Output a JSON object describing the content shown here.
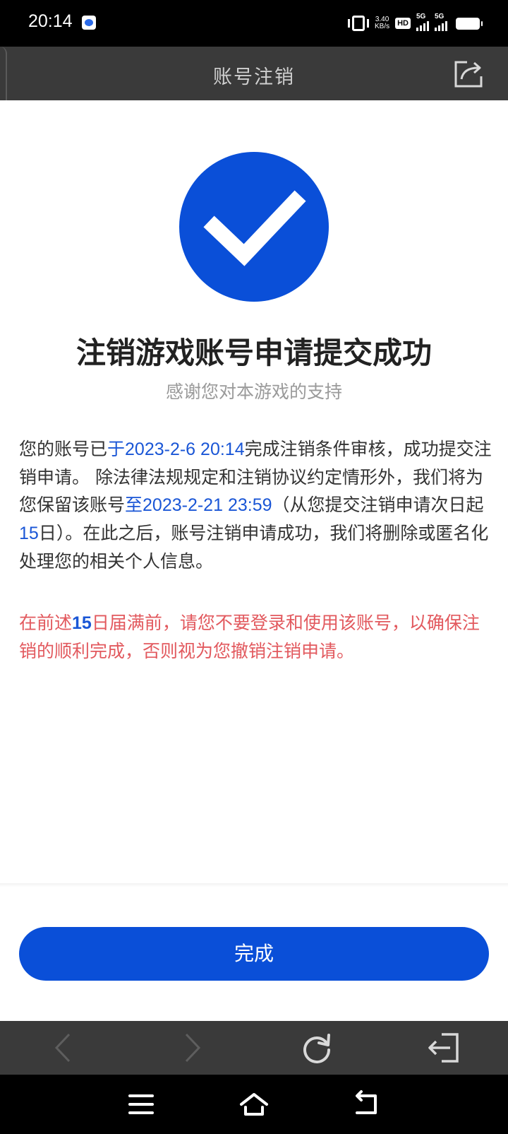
{
  "status_bar": {
    "time": "20:14",
    "net_speed_value": "3.40",
    "net_speed_unit": "KB/s",
    "hd_label": "HD",
    "signal_label_1": "5G",
    "signal_label_2": "5G"
  },
  "header": {
    "title": "账号注销"
  },
  "result": {
    "title": "注销游戏账号申请提交成功",
    "subtitle": "感谢您对本游戏的支持"
  },
  "info": {
    "p1": "您的账号已",
    "date1": "于2023-2-6 20:14",
    "p2": "完成注销条件审核，成功提交注销申请。 除法律法规规定和注销协议约定情形外，我们将为您保留该账号",
    "date2": "至2023-2-21 23:59",
    "p3": "（从您提交注销申请次日起",
    "days": "15",
    "p4": "日）。在此之后，账号注销申请成功，我们将删除或匿名化处理您的相关个人信息。"
  },
  "warning": {
    "p1": "在前述",
    "days": "15",
    "p2": "日届满前，请您不要登录和使用该账号，以确保注销的顺利完成，否则视为您撤销注销申请。"
  },
  "actions": {
    "done_label": "完成"
  },
  "colors": {
    "accent": "#0a4fd8",
    "warning": "#e2595e",
    "header_bg": "#3a3a3a"
  },
  "icons": {
    "share": "share-icon",
    "back": "back-arrow-icon",
    "forward": "forward-arrow-icon",
    "refresh": "refresh-icon",
    "exit": "exit-icon",
    "menu": "menu-icon",
    "home": "home-icon",
    "return": "return-icon"
  }
}
